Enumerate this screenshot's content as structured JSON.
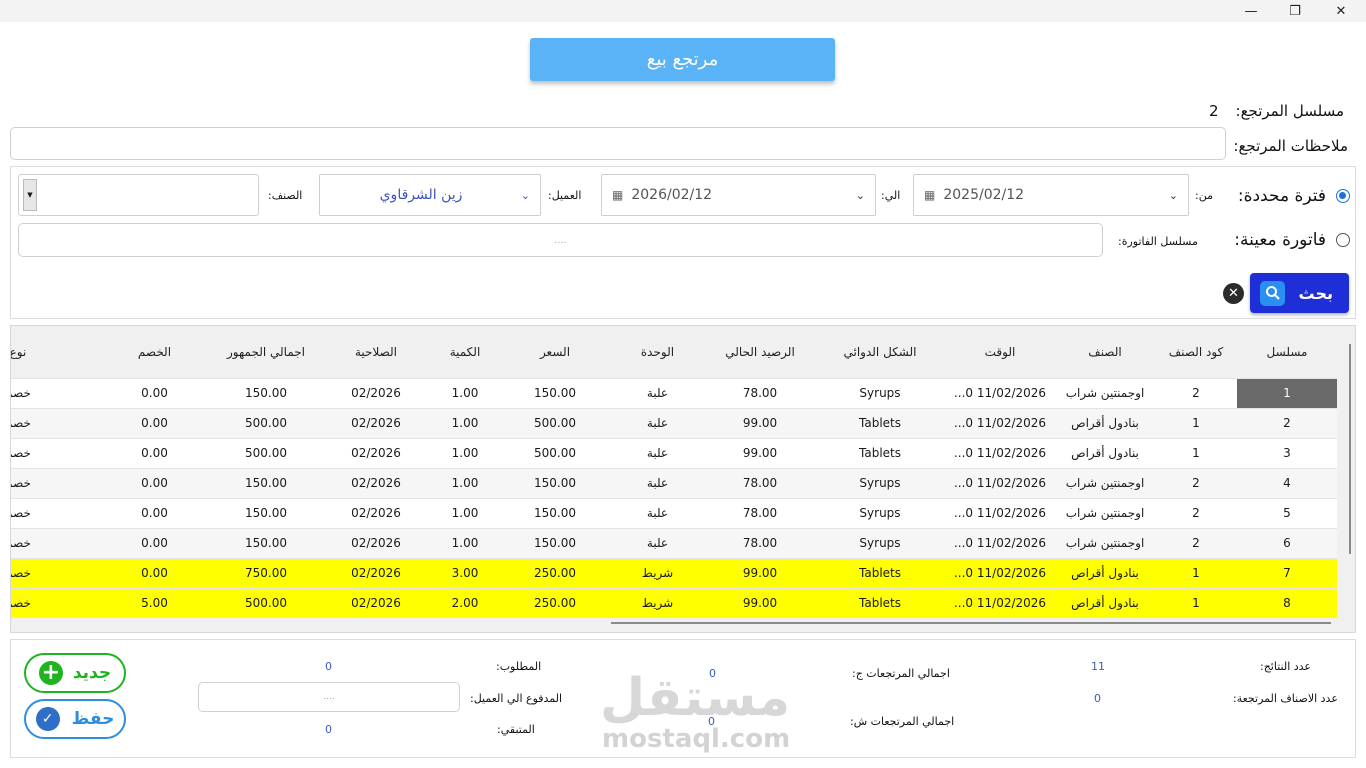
{
  "window": {
    "minimize": "—",
    "maximize": "❐",
    "close": "✕"
  },
  "header": {
    "title": "مرتجع بيع"
  },
  "return_info": {
    "serial_label": "مسلسل المرتجع:",
    "serial_value": "2",
    "notes_label": "ملاحظات المرتجع:"
  },
  "filters": {
    "period_label": "فترة محددة:",
    "period_selected": true,
    "from_label": "من:",
    "from_date": "2025/02/12",
    "to_label": "الي:",
    "to_date": "2026/02/12",
    "customer_label": "العميل:",
    "customer_value": "زين الشرقاوي",
    "item_label": "الصنف:",
    "invoice_label": "فاتورة معينة:",
    "invoice_serial_label": "مسلسل الفاتورة:",
    "invoice_placeholder": "....",
    "search_label": "بحث"
  },
  "table": {
    "columns": [
      "مسلسل",
      "كود الصنف",
      "الصنف",
      "الوقت",
      "الشكل الدوائي",
      "الرصيد الحالي",
      "الوحدة",
      "السعر",
      "الكمية",
      "الصلاحية",
      "اجمالي الجمهور",
      "الخصم",
      "نوع"
    ],
    "rows": [
      [
        "1",
        "2",
        "اوجمنتين شراب",
        "11/02/2026 0...",
        "Syrups",
        "78.00",
        "علبة",
        "150.00",
        "1.00",
        "02/2026",
        "150.00",
        "0.00",
        "خصم"
      ],
      [
        "2",
        "1",
        "بنادول أقراص",
        "11/02/2026 0...",
        "Tablets",
        "99.00",
        "علبة",
        "500.00",
        "1.00",
        "02/2026",
        "500.00",
        "0.00",
        "خصم"
      ],
      [
        "3",
        "1",
        "بنادول أقراص",
        "11/02/2026 0...",
        "Tablets",
        "99.00",
        "علبة",
        "500.00",
        "1.00",
        "02/2026",
        "500.00",
        "0.00",
        "خصم"
      ],
      [
        "4",
        "2",
        "اوجمنتين شراب",
        "11/02/2026 0...",
        "Syrups",
        "78.00",
        "علبة",
        "150.00",
        "1.00",
        "02/2026",
        "150.00",
        "0.00",
        "خصم"
      ],
      [
        "5",
        "2",
        "اوجمنتين شراب",
        "11/02/2026 0...",
        "Syrups",
        "78.00",
        "علبة",
        "150.00",
        "1.00",
        "02/2026",
        "150.00",
        "0.00",
        "خصم"
      ],
      [
        "6",
        "2",
        "اوجمنتين شراب",
        "11/02/2026 0...",
        "Syrups",
        "78.00",
        "علبة",
        "150.00",
        "1.00",
        "02/2026",
        "150.00",
        "0.00",
        "خصم"
      ],
      [
        "7",
        "1",
        "بنادول أقراص",
        "11/02/2026 0...",
        "Tablets",
        "99.00",
        "شريط",
        "250.00",
        "3.00",
        "02/2026",
        "750.00",
        "0.00",
        "خصم"
      ],
      [
        "8",
        "1",
        "بنادول أقراص",
        "11/02/2026 0...",
        "Tablets",
        "99.00",
        "شريط",
        "250.00",
        "2.00",
        "02/2026",
        "500.00",
        "5.00",
        "خصم"
      ]
    ],
    "highlighted_rows": [
      6,
      7
    ]
  },
  "summary": {
    "results_count_label": "عدد النتائج:",
    "results_count": "11",
    "returned_items_label": "عدد الاصناف المرتجعة:",
    "returned_items": "0",
    "total_returns_c_label": "اجمالي المرتجعات ج:",
    "total_returns_c": "0",
    "total_returns_s_label": "اجمالي المرتجعات ش:",
    "total_returns_s": "0",
    "required_label": "المطلوب:",
    "required": "0",
    "paid_label": "المدفوع الي العميل:",
    "paid_placeholder": "....",
    "remaining_label": "المتبقي:",
    "remaining": "0"
  },
  "actions": {
    "new_label": "جديد",
    "save_label": "حفظ"
  },
  "watermark": {
    "text": "مستقل",
    "site": "mostaql.com"
  },
  "colors": {
    "accent": "#5ab2f7",
    "search": "#1e2fd8",
    "new": "#1fb321",
    "save": "#2d8de0",
    "highlight": "#ffff00"
  }
}
